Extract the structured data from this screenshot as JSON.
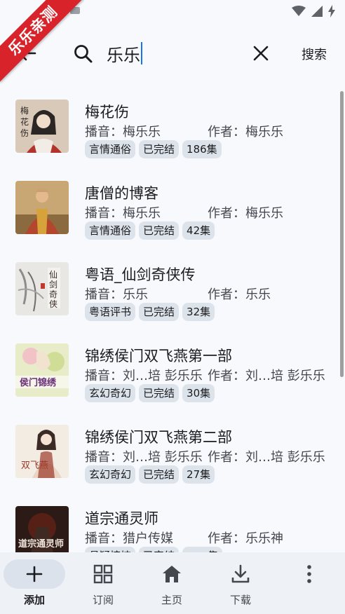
{
  "ribbon": "乐乐亲测",
  "search": {
    "query": "乐乐",
    "submit_label": "搜索"
  },
  "results": [
    {
      "title": "梅花伤",
      "narrator": "播音：梅乐乐",
      "author": "作者：梅乐乐",
      "tags": [
        "言情通俗",
        "已完结",
        "186集"
      ],
      "cover": {
        "bg": "#d9c9b8",
        "accent": "#b2322c",
        "text": "梅花伤"
      }
    },
    {
      "title": "唐僧的博客",
      "narrator": "播音：梅乐乐",
      "author": "作者：梅乐乐",
      "tags": [
        "言情通俗",
        "已完结",
        "42集"
      ],
      "cover": {
        "bg": "#c9a774",
        "accent": "#b5462e",
        "text": ""
      }
    },
    {
      "title": "粤语_仙剑奇侠传",
      "narrator": "播音：乐乐",
      "author": "作者：乐乐",
      "tags": [
        "粤语评书",
        "已完结",
        "32集"
      ],
      "cover": {
        "bg": "#e9e7e3",
        "accent": "#5a4d41",
        "text": "仙剑奇侠传"
      }
    },
    {
      "title": "锦绣侯门双飞燕第一部",
      "narrator": "播音：刘…培 彭乐乐",
      "author": "作者：刘…培 彭乐乐",
      "tags": [
        "玄幻奇幻",
        "已完结",
        "30集"
      ],
      "cover": {
        "bg": "#e8ecc9",
        "accent": "#6a2e78",
        "text": "侯门锦绣"
      }
    },
    {
      "title": "锦绣侯门双飞燕第二部",
      "narrator": "播音：刘…培 彭乐乐",
      "author": "作者：刘…培 彭乐乐",
      "tags": [
        "玄幻奇幻",
        "已完结",
        "27集"
      ],
      "cover": {
        "bg": "#f3ece2",
        "accent": "#9b3a2a",
        "text": "双飞燕"
      }
    },
    {
      "title": "道宗通灵师",
      "narrator": "播音：猎户传媒",
      "author": "作者：乐乐神",
      "tags": [
        "悬疑惊悚",
        "已完结",
        "……集"
      ],
      "cover": {
        "bg": "#2b1a16",
        "accent": "#c24a2a",
        "text": "道宗通灵师"
      }
    }
  ],
  "nav": [
    {
      "label": "添加",
      "icon": "plus-icon",
      "active": true
    },
    {
      "label": "订阅",
      "icon": "grid-icon",
      "active": false
    },
    {
      "label": "主页",
      "icon": "home-icon",
      "active": false
    },
    {
      "label": "下载",
      "icon": "download-icon",
      "active": false
    },
    {
      "label": "",
      "icon": "more-vertical-icon",
      "active": false
    }
  ]
}
